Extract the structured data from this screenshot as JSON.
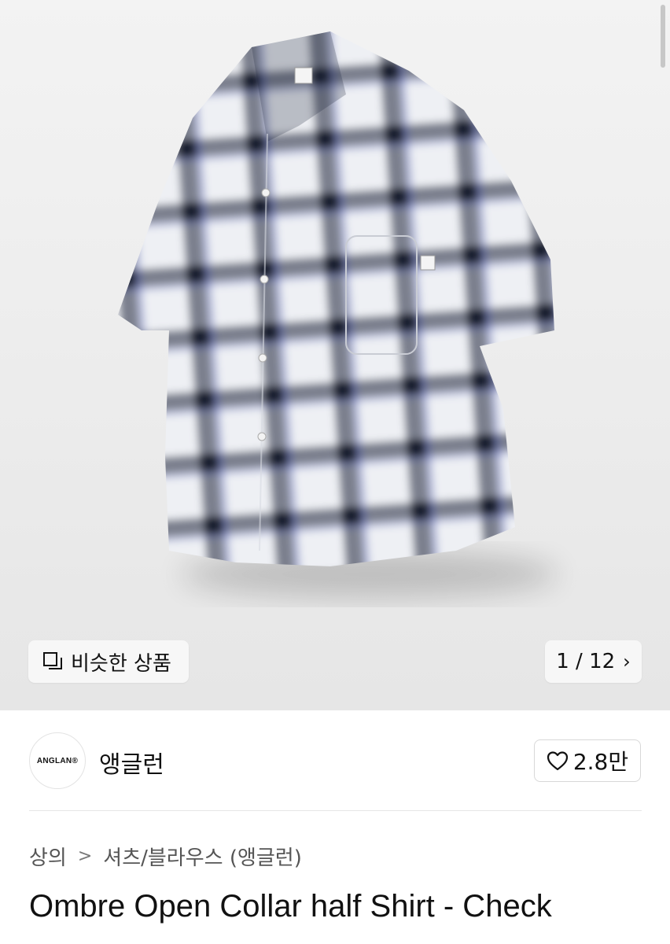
{
  "gallery": {
    "similar_label": "비슷한 상품",
    "page_indicator": "1 / 12",
    "shirt_colors": {
      "base": "#eef0f4",
      "check": "#1b2338",
      "accent": "#2b3fae"
    }
  },
  "brand": {
    "logo_text": "ANGLAN®",
    "name": "앵글런",
    "likes": "2.8만"
  },
  "breadcrumb": {
    "category": "상의",
    "subcategory": "셔츠/블라우스 (앵글런)"
  },
  "product": {
    "title": "Ombre Open Collar half Shirt - Check"
  }
}
